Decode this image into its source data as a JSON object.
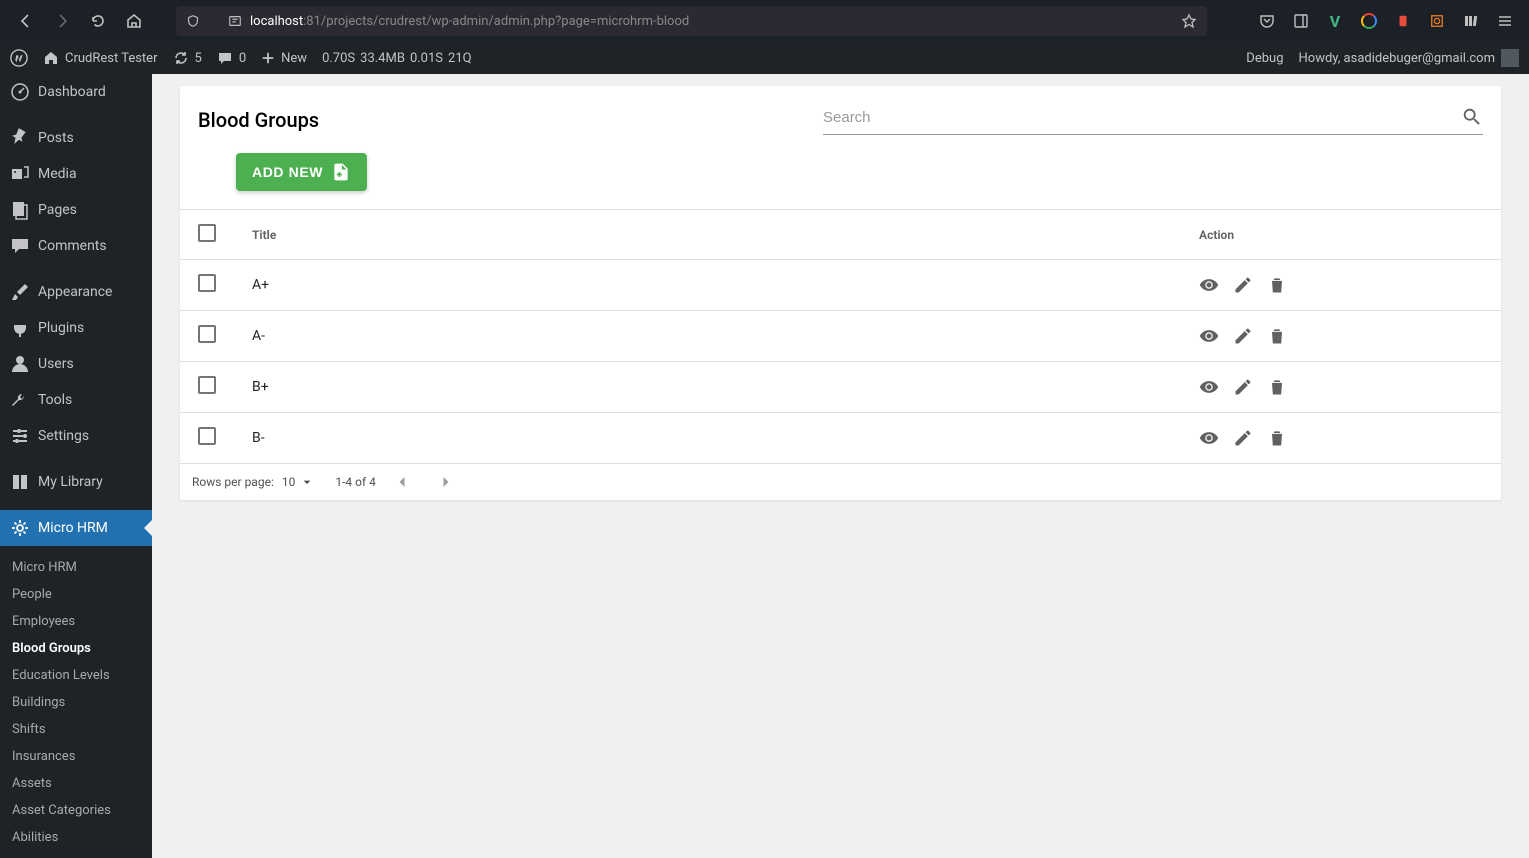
{
  "browser": {
    "url_host": "localhost",
    "url_rest": ":81/projects/crudrest/wp-admin/admin.php?page=microhrm-blood"
  },
  "adminbar": {
    "site_name": "CrudRest Tester",
    "updates": "5",
    "comments": "0",
    "new_label": "New",
    "metrics": {
      "time1": "0.70S",
      "mem": "33.4MB",
      "time2": "0.01S",
      "q": "21Q"
    },
    "debug": "Debug",
    "howdy": "Howdy, asadidebuger@gmail.com"
  },
  "sidebar": {
    "main": [
      {
        "id": "dashboard",
        "label": "Dashboard",
        "icon": "gauge"
      },
      {
        "id": "posts",
        "label": "Posts",
        "icon": "pin"
      },
      {
        "id": "media",
        "label": "Media",
        "icon": "media"
      },
      {
        "id": "pages",
        "label": "Pages",
        "icon": "page"
      },
      {
        "id": "comments",
        "label": "Comments",
        "icon": "comment"
      },
      {
        "id": "appearance",
        "label": "Appearance",
        "icon": "brush"
      },
      {
        "id": "plugins",
        "label": "Plugins",
        "icon": "plug"
      },
      {
        "id": "users",
        "label": "Users",
        "icon": "user"
      },
      {
        "id": "tools",
        "label": "Tools",
        "icon": "wrench"
      },
      {
        "id": "settings",
        "label": "Settings",
        "icon": "sliders"
      },
      {
        "id": "mylibrary",
        "label": "My Library",
        "icon": "book"
      },
      {
        "id": "microhrm",
        "label": "Micro HRM",
        "icon": "gear",
        "active": true
      }
    ],
    "sub": [
      {
        "id": "microhrm-home",
        "label": "Micro HRM"
      },
      {
        "id": "people",
        "label": "People"
      },
      {
        "id": "employees",
        "label": "Employees"
      },
      {
        "id": "blood-groups",
        "label": "Blood Groups",
        "current": true
      },
      {
        "id": "education-levels",
        "label": "Education Levels"
      },
      {
        "id": "buildings",
        "label": "Buildings"
      },
      {
        "id": "shifts",
        "label": "Shifts"
      },
      {
        "id": "insurances",
        "label": "Insurances"
      },
      {
        "id": "assets",
        "label": "Assets"
      },
      {
        "id": "asset-categories",
        "label": "Asset Categories"
      },
      {
        "id": "abilities",
        "label": "Abilities"
      }
    ]
  },
  "content": {
    "title": "Blood Groups",
    "search_placeholder": "Search",
    "add_new": "ADD NEW",
    "columns": {
      "title": "Title",
      "action": "Action"
    },
    "rows": [
      {
        "title": "A+"
      },
      {
        "title": "A-"
      },
      {
        "title": "B+"
      },
      {
        "title": "B-"
      }
    ],
    "footer": {
      "rpp_label": "Rows per page:",
      "rpp_value": "10",
      "range": "1-4 of 4"
    }
  }
}
